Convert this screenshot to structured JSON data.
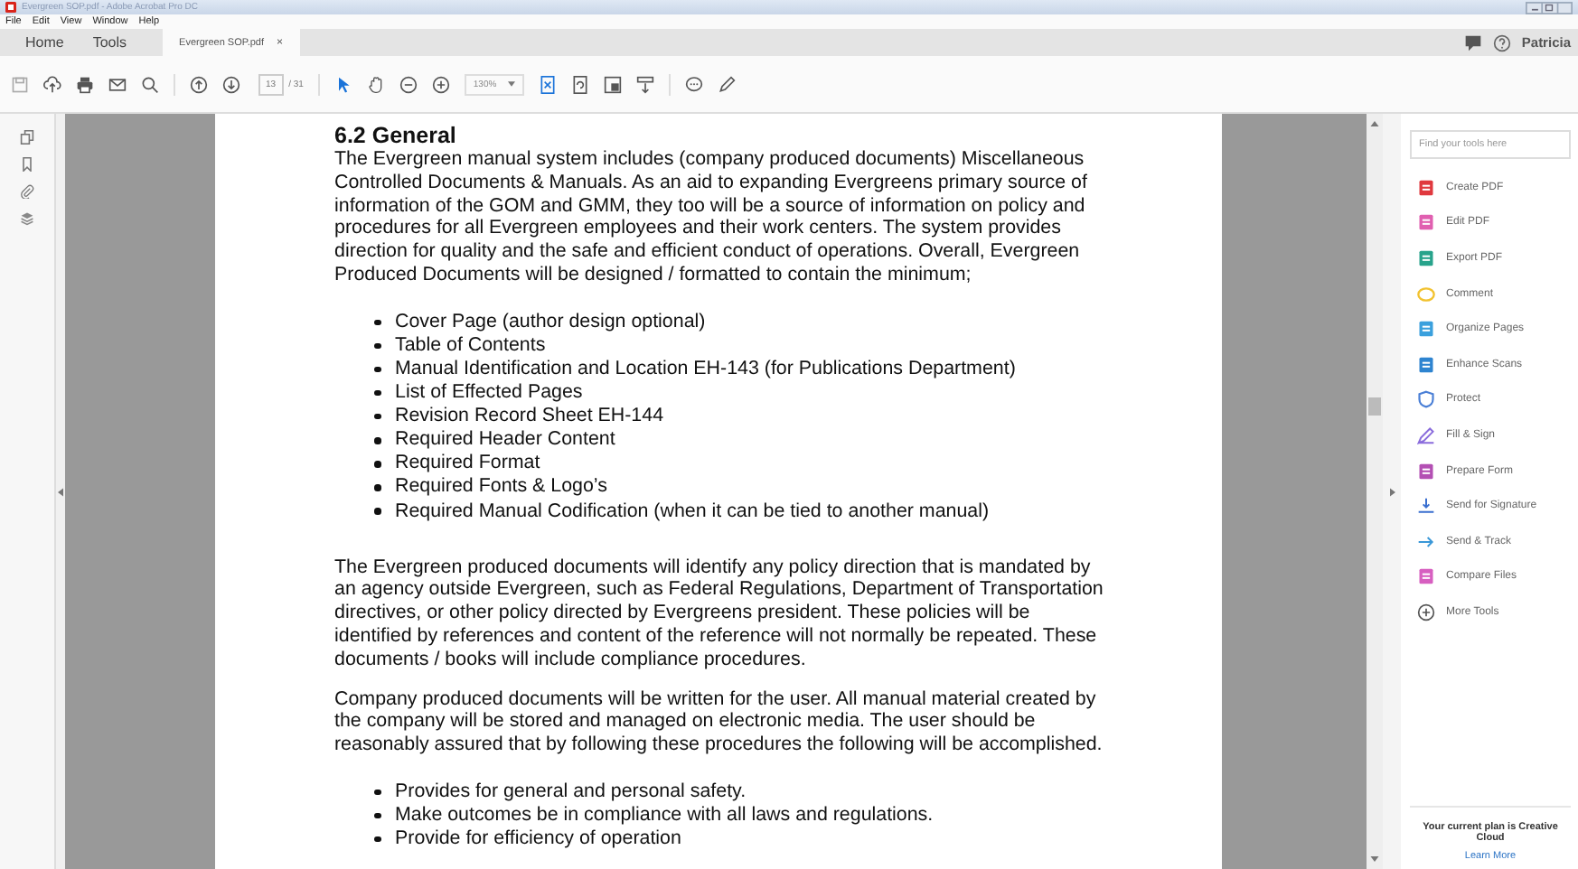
{
  "window": {
    "title": "Evergreen SOP.pdf - Adobe Acrobat Pro DC"
  },
  "menu": [
    "File",
    "Edit",
    "View",
    "Window",
    "Help"
  ],
  "tabs": [
    {
      "label": "Home",
      "kind": "nav",
      "selected": false
    },
    {
      "label": "Tools",
      "kind": "nav",
      "selected": false
    },
    {
      "label": "Evergreen SOP.pdf",
      "kind": "doc",
      "selected": true,
      "close": "×"
    }
  ],
  "user": "Patricia",
  "toolbar": {
    "page": "13",
    "page_total": "/ 31",
    "zoom": "130%"
  },
  "document": {
    "heading": "6.2   General",
    "blocks": [
      {
        "kind": "paragraph",
        "text": "The Evergreen manual system includes (company produced documents) Miscellaneous Controlled Documents & Manuals. As an aid to expanding Evergreens primary source of information of the GOM and GMM, they too will be a source of information on policy and procedures for all Evergreen employees and their work centers. The system provides direction for quality and the safe and efficient conduct of operations. Overall, Evergreen Produced Documents will be designed / formatted to contain the minimum;"
      },
      {
        "kind": "list",
        "items": [
          "Cover Page (author design optional)",
          "Table of Contents",
          "Manual Identification and Location EH-143 (for Publications Department)",
          "List of  Effected Pages",
          "Revision Record Sheet EH-144",
          "Required Header Content",
          "Required Format",
          "Required Fonts & Logo’s",
          "Required Manual Codification (when it can be tied to another manual)"
        ]
      },
      {
        "kind": "paragraph",
        "text": "The Evergreen produced documents will identify any policy direction that is mandated by an agency outside Evergreen, such as Federal Regulations, Department of Transportation directives, or other policy directed by Evergreens president. These policies will be identified by references and content of the reference will not normally be repeated. These documents / books will include compliance procedures."
      },
      {
        "kind": "paragraph",
        "text": "Company produced documents will be written for the user. All manual material created by the company will be stored and managed on electronic media. The user should be reasonably assured that by following these procedures the following will be accomplished."
      },
      {
        "kind": "list",
        "items": [
          "Provides for general and personal safety.",
          "Make outcomes be in compliance with all laws and regulations.",
          "Provide for efficiency of operation"
        ]
      }
    ]
  },
  "tools_panel": {
    "search": {
      "placeholder": "Find your tools here"
    },
    "tools": [
      {
        "label": "Create PDF",
        "kind": "tool",
        "color": "#e0393e"
      },
      {
        "label": "Edit PDF",
        "kind": "tool",
        "color": "#e05fb0"
      },
      {
        "label": "Export PDF",
        "kind": "tool",
        "color": "#27a38b"
      },
      {
        "label": "Comment",
        "kind": "comment",
        "color": "#f2c230"
      },
      {
        "label": "Organize Pages",
        "kind": "tool",
        "color": "#3aa0dd"
      },
      {
        "label": "Enhance Scans",
        "kind": "tool",
        "color": "#2e84d0"
      },
      {
        "label": "Protect",
        "kind": "shield",
        "color": "#4a7fd6"
      },
      {
        "label": "Fill & Sign",
        "kind": "pen",
        "color": "#8a6cdc"
      },
      {
        "label": "Prepare Form",
        "kind": "tool",
        "color": "#b34fb3"
      },
      {
        "label": "Send for Signature",
        "kind": "sign",
        "color": "#3a6fd0"
      },
      {
        "label": "Send & Track",
        "kind": "arrow",
        "color": "#3a98d8"
      },
      {
        "label": "Compare Files",
        "kind": "tool",
        "color": "#d75fc0"
      },
      {
        "label": "More Tools",
        "kind": "more",
        "color": "#555555"
      }
    ],
    "plan": "Your current plan is Creative Cloud",
    "learn_more": "Learn More"
  }
}
